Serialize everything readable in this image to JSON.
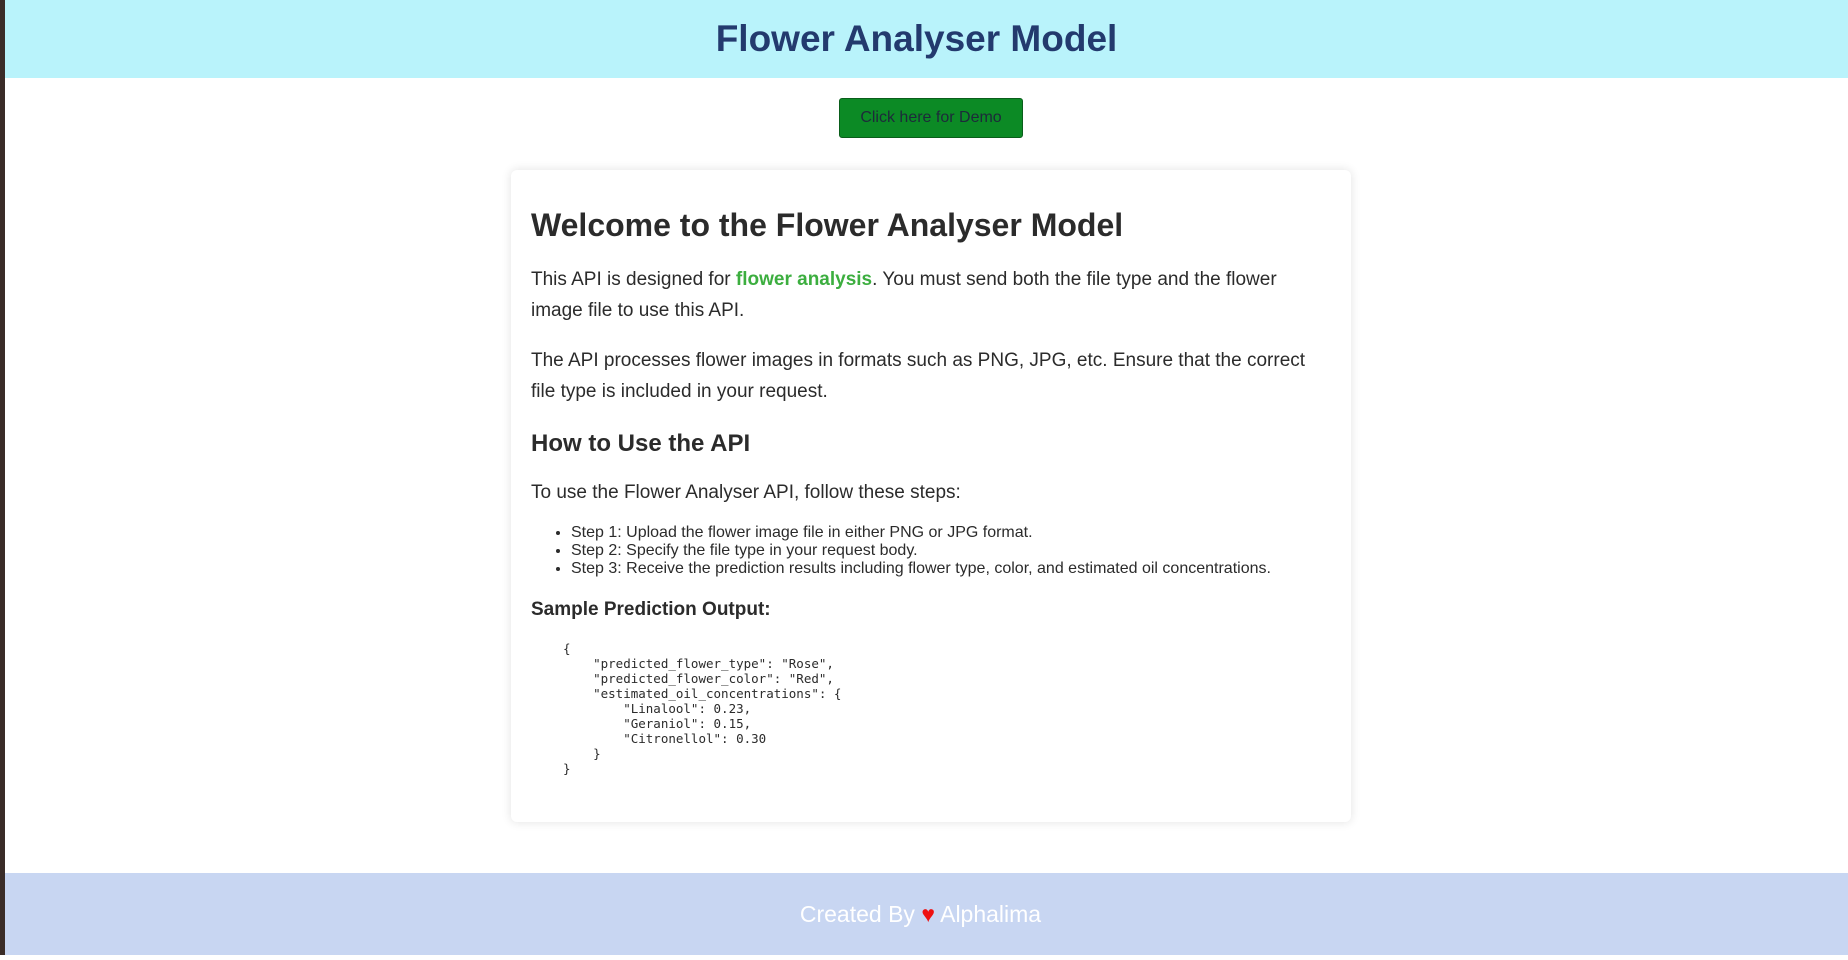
{
  "header": {
    "title": "Flower Analyser Model"
  },
  "demo_button": {
    "label": "Click here for Demo"
  },
  "main": {
    "heading": "Welcome to the Flower Analyser Model",
    "intro": {
      "before": "This API is designed for ",
      "highlight": "flower analysis",
      "after": ". You must send both the file type and the flower image file to use this API."
    },
    "formats_text": "The API processes flower images in formats such as PNG, JPG, etc. Ensure that the correct file type is included in your request.",
    "how_to_heading": "How to Use the API",
    "how_to_intro": "To use the Flower Analyser API, follow these steps:",
    "steps": [
      "Step 1: Upload the flower image file in either PNG or JPG format.",
      "Step 2: Specify the file type in your request body.",
      "Step 3: Receive the prediction results including flower type, color, and estimated oil concentrations."
    ],
    "sample_heading": "Sample Prediction Output:",
    "sample_code": "{\n    \"predicted_flower_type\": \"Rose\",\n    \"predicted_flower_color\": \"Red\",\n    \"estimated_oil_concentrations\": {\n        \"Linalool\": 0.23,\n        \"Geraniol\": 0.15,\n        \"Citronellol\": 0.30\n    }\n}"
  },
  "footer": {
    "prefix": "Created By ",
    "heart": "♥",
    "author": " Alphalima"
  },
  "colors": {
    "header_bg": "#b9f3fb",
    "title": "#233a6e",
    "button_bg": "#0c8a25",
    "highlight": "#3cae3f",
    "footer_bg": "#c8d6f2",
    "heart": "#ee1111"
  }
}
